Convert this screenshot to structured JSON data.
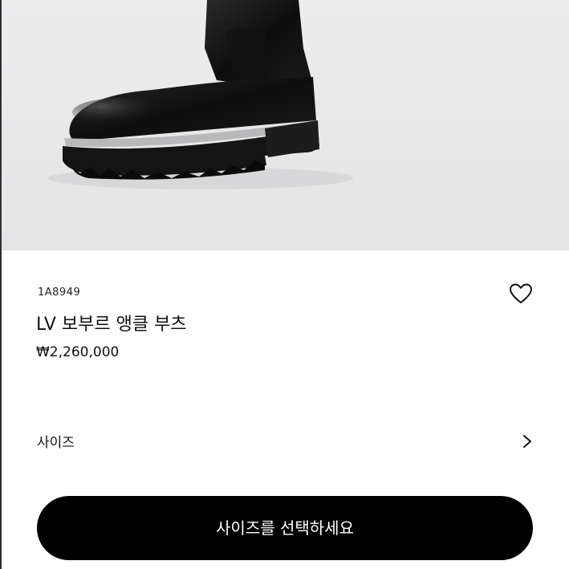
{
  "product": {
    "sku": "1A8949",
    "title": "LV 보부르 앵클 부츠",
    "price": "₩2,260,000"
  },
  "options": {
    "size_label": "사이즈"
  },
  "cta": {
    "label": "사이즈를 선택하세요"
  },
  "icons": {
    "wishlist": "heart-outline-icon",
    "size_arrow": "chevron-right-icon"
  },
  "colors": {
    "cta_background": "#000000",
    "cta_text": "#ffffff",
    "hero_background": "#e9e9ea"
  }
}
